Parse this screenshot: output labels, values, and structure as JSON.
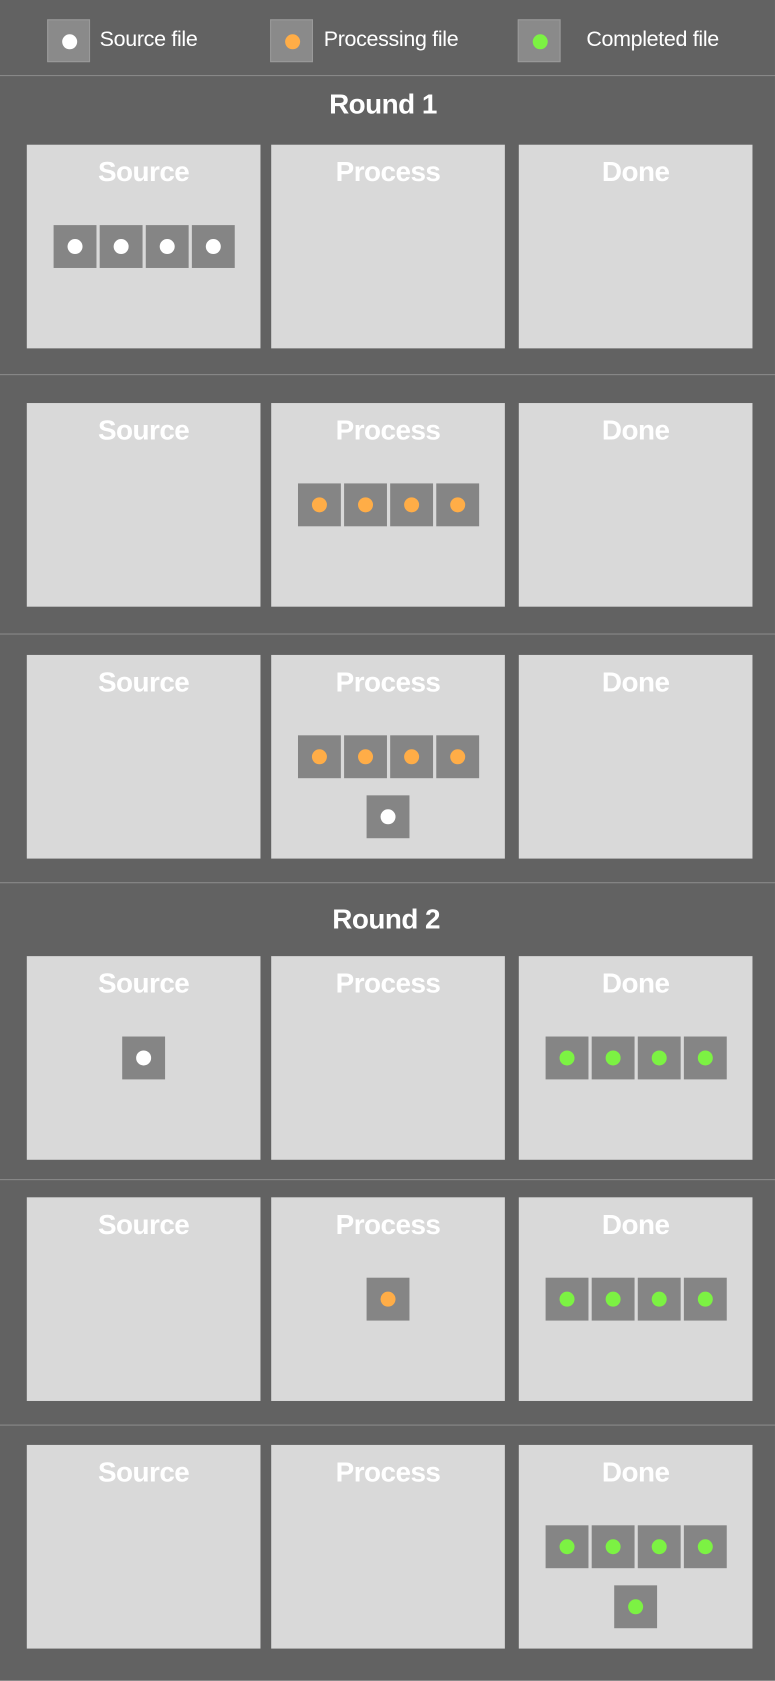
{
  "colors": {
    "background": "#626262",
    "panel": "#d9d9d9",
    "file_chip": "#858585",
    "source": "#ffffff",
    "processing": "#ffad47",
    "completed": "#7cf243"
  },
  "legend": [
    {
      "label": "Source file",
      "state": "source",
      "icon": "white-dot-icon"
    },
    {
      "label": "Processing file",
      "state": "processing",
      "icon": "orange-dot-icon"
    },
    {
      "label": "Completed file",
      "state": "completed",
      "icon": "green-dot-icon"
    }
  ],
  "rounds": [
    {
      "title": "Round 1"
    },
    {
      "title": "Round 2"
    }
  ],
  "panel_labels": {
    "source": "Source",
    "process": "Process",
    "done": "Done"
  },
  "steps": [
    {
      "round": 1,
      "source": [
        "source",
        "source",
        "source",
        "source"
      ],
      "process": [],
      "done": []
    },
    {
      "round": 1,
      "source": [],
      "process": [
        "processing",
        "processing",
        "processing",
        "processing"
      ],
      "done": []
    },
    {
      "round": 1,
      "source": [],
      "process": [
        "processing",
        "processing",
        "processing",
        "processing",
        "source"
      ],
      "done": []
    },
    {
      "round": 2,
      "source": [
        "source"
      ],
      "process": [],
      "done": [
        "completed",
        "completed",
        "completed",
        "completed"
      ]
    },
    {
      "round": 2,
      "source": [],
      "process": [
        "processing"
      ],
      "done": [
        "completed",
        "completed",
        "completed",
        "completed"
      ]
    },
    {
      "round": 2,
      "source": [],
      "process": [],
      "done": [
        "completed",
        "completed",
        "completed",
        "completed",
        "completed"
      ]
    }
  ]
}
